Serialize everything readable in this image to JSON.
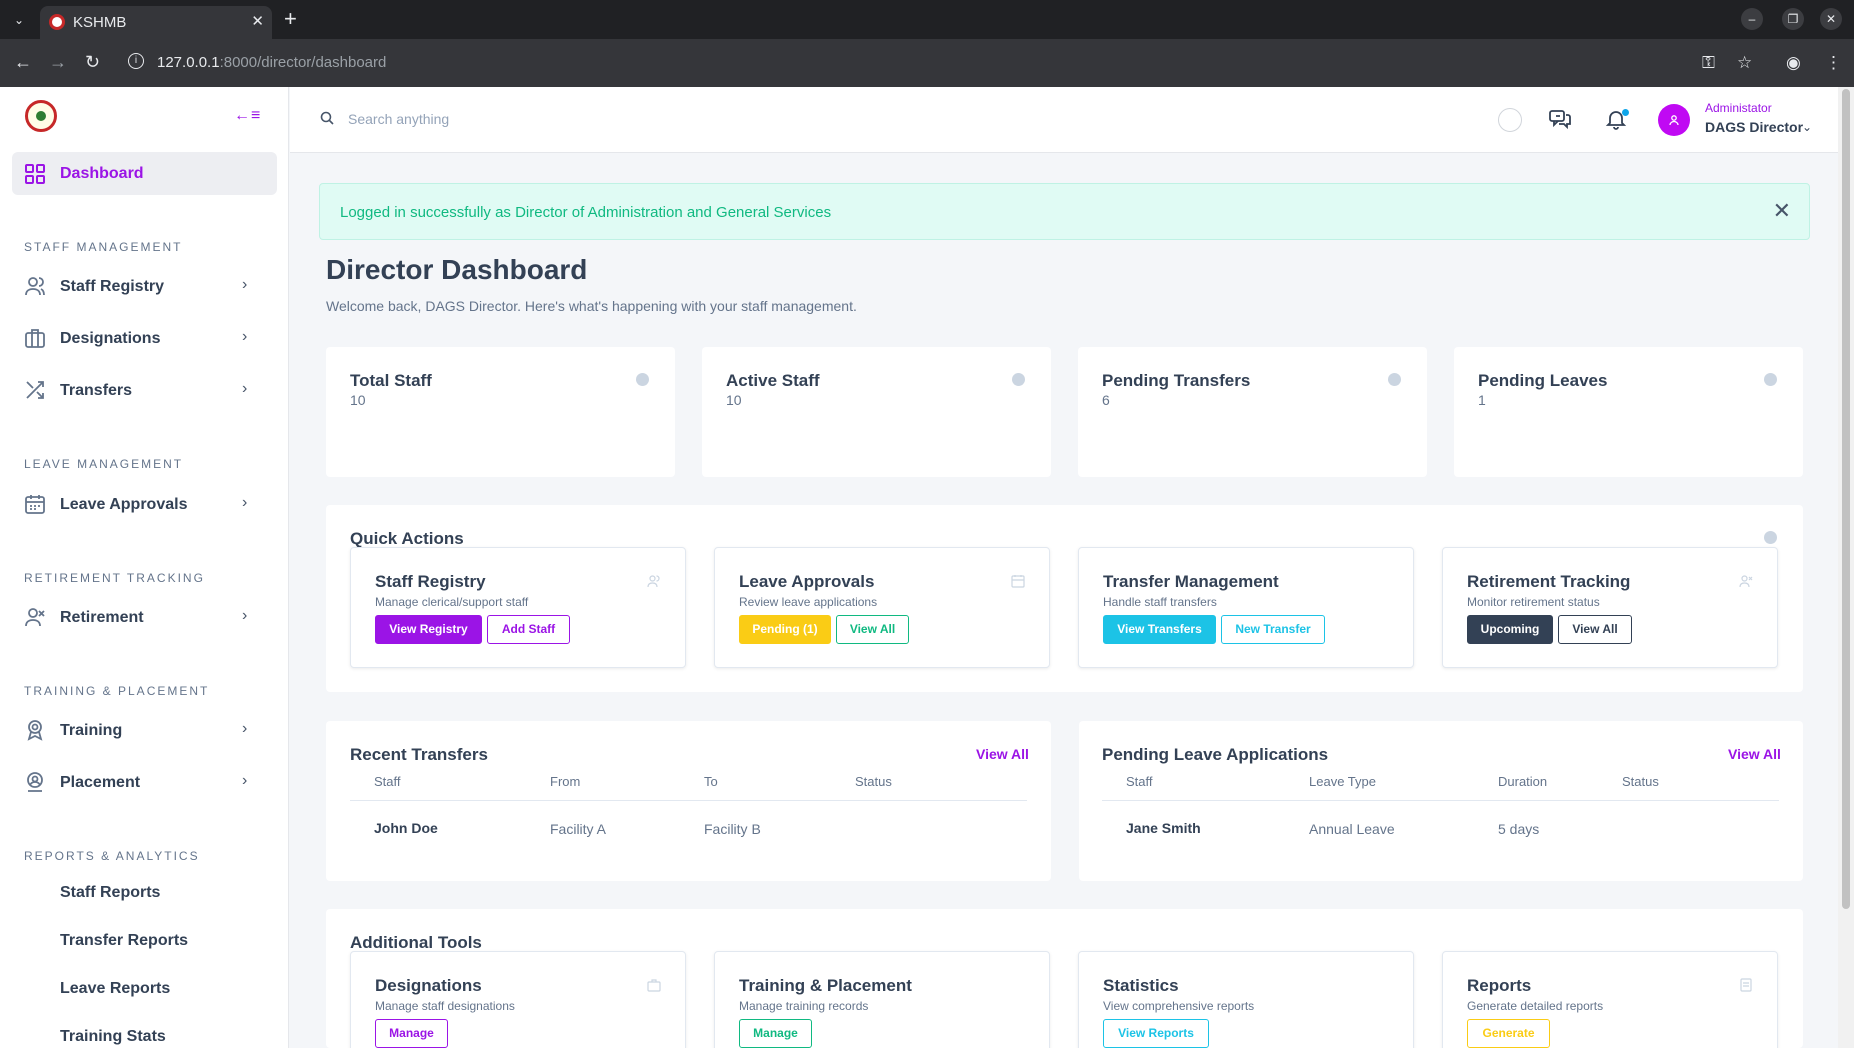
{
  "browser": {
    "tab_title": "KSHMB",
    "url_host": "127.0.0.1",
    "url_path": ":8000/director/dashboard"
  },
  "sidebar": {
    "dashboard_label": "Dashboard",
    "sections": {
      "staff": "STAFF MANAGEMENT",
      "leave": "LEAVE MANAGEMENT",
      "retirement": "RETIREMENT TRACKING",
      "training": "TRAINING & PLACEMENT",
      "reports": "REPORTS & ANALYTICS"
    },
    "items": {
      "staff_registry": "Staff Registry",
      "designations": "Designations",
      "transfers": "Transfers",
      "leave_approvals": "Leave Approvals",
      "retirement": "Retirement",
      "training": "Training",
      "placement": "Placement"
    },
    "reports": [
      "Staff Reports",
      "Transfer Reports",
      "Leave Reports",
      "Training Stats"
    ]
  },
  "header": {
    "search_placeholder": "Search anything",
    "user_role": "Administator",
    "user_name": "DAGS Director"
  },
  "alert": {
    "message": "Logged in successfully as Director of Administration and General Services"
  },
  "page": {
    "title": "Director Dashboard",
    "subtitle": "Welcome back, DAGS Director. Here's what's happening with your staff management."
  },
  "stats": [
    {
      "title": "Total Staff",
      "value": "10"
    },
    {
      "title": "Active Staff",
      "value": "10"
    },
    {
      "title": "Pending Transfers",
      "value": "6"
    },
    {
      "title": "Pending Leaves",
      "value": "1"
    }
  ],
  "quick_actions": {
    "title": "Quick Actions",
    "cards": [
      {
        "title": "Staff Registry",
        "desc": "Manage clerical/support staff",
        "btn1": "View Registry",
        "btn2": "Add Staff"
      },
      {
        "title": "Leave Approvals",
        "desc": "Review leave applications",
        "btn1": "Pending (1)",
        "btn2": "View All"
      },
      {
        "title": "Transfer Management",
        "desc": "Handle staff transfers",
        "btn1": "View Transfers",
        "btn2": "New Transfer"
      },
      {
        "title": "Retirement Tracking",
        "desc": "Monitor retirement status",
        "btn1": "Upcoming",
        "btn2": "View All"
      }
    ]
  },
  "recent_transfers": {
    "title": "Recent Transfers",
    "view_all": "View All",
    "columns": [
      "Staff",
      "From",
      "To",
      "Status"
    ],
    "rows": [
      [
        "John Doe",
        "Facility A",
        "Facility B",
        ""
      ]
    ]
  },
  "pending_leaves": {
    "title": "Pending Leave Applications",
    "view_all": "View All",
    "columns": [
      "Staff",
      "Leave Type",
      "Duration",
      "Status"
    ],
    "rows": [
      [
        "Jane Smith",
        "Annual Leave",
        "5 days",
        ""
      ]
    ]
  },
  "additional_tools": {
    "title": "Additional Tools",
    "cards": [
      {
        "title": "Designations",
        "desc": "Manage staff designations",
        "btn": "Manage"
      },
      {
        "title": "Training & Placement",
        "desc": "Manage training records",
        "btn": "Manage"
      },
      {
        "title": "Statistics",
        "desc": "View comprehensive reports",
        "btn": "View Reports"
      },
      {
        "title": "Reports",
        "desc": "Generate detailed reports",
        "btn": "Generate"
      }
    ]
  },
  "colors": {
    "accent": "#9b14e6",
    "warning": "#facc15",
    "info": "#1cc3e6",
    "dark": "#334155",
    "success": "#10b981"
  }
}
